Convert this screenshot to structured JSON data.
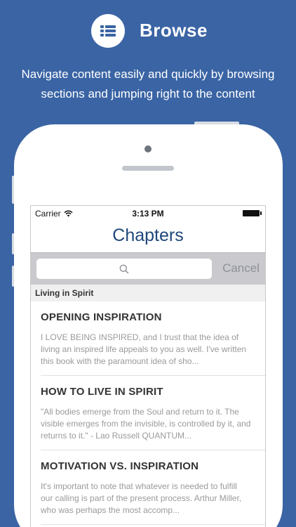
{
  "header": {
    "icon": "list-icon",
    "title": "Browse",
    "tagline_line1": "Navigate content easily and quickly by browsing",
    "tagline_line2": "sections and jumping right to the content"
  },
  "status_bar": {
    "carrier": "Carrier",
    "time": "3:13 PM"
  },
  "nav": {
    "title": "Chapters"
  },
  "search": {
    "placeholder": "",
    "cancel_label": "Cancel"
  },
  "section": {
    "title": "Living in Spirit"
  },
  "chapters": [
    {
      "title": "OPENING INSPIRATION",
      "excerpt": "I LOVE BEING INSPIRED, and I trust that the idea of living an inspired life appeals to you as well. I've written this book with the paramount idea of sho..."
    },
    {
      "title": "HOW TO LIVE IN SPIRIT",
      "excerpt": "\"All bodies emerge from the Soul and return to it. The visible emerges from the invisible, is controlled by it, and returns to it.\" - Lao Russell QUANTUM..."
    },
    {
      "title": "MOTIVATION VS. INSPIRATION",
      "excerpt": "It's important to note that whatever is needed to fulfill our calling is part of the present process. Arthur Miller, who was perhaps the most accomp..."
    }
  ],
  "colors": {
    "background": "#3a64a4",
    "nav_title": "#1f477a",
    "cancel": "#8e9299"
  }
}
